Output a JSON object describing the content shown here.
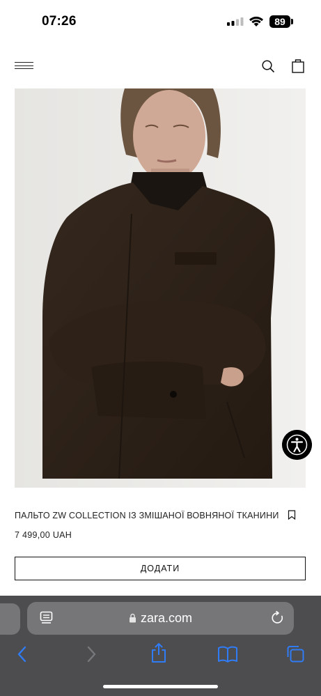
{
  "status_bar": {
    "time": "07:26",
    "battery": "89"
  },
  "product": {
    "name": "ПАЛЬТО ZW COLLECTION ІЗ ЗМІШАНОЇ ВОВНЯНОЇ ТКАНИНИ",
    "price": "7 499,00 UAH",
    "add_label": "ДОДАТИ"
  },
  "browser": {
    "url": "zara.com"
  },
  "colors": {
    "browser_bar": "#4d4d4f",
    "link_blue": "#2f7cf6",
    "coat": "#2c2017"
  },
  "icons": {
    "header": [
      "menu-icon",
      "search-icon",
      "shopping-bag-icon"
    ],
    "toolbar": [
      "back-icon",
      "forward-icon",
      "share-icon",
      "bookmarks-icon",
      "tabs-icon"
    ]
  }
}
